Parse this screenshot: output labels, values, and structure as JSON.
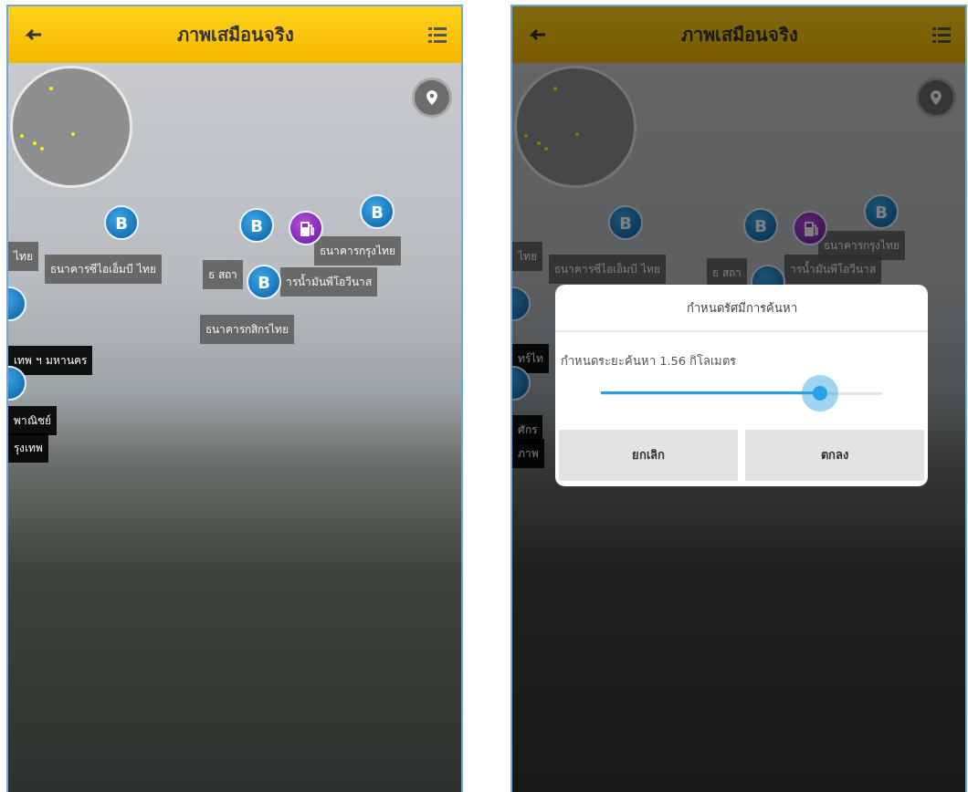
{
  "screens": [
    {
      "app_bar": {
        "title": "ภาพเสมือนจริง"
      },
      "markers": [
        {
          "kind": "bank",
          "symbol": "B"
        },
        {
          "kind": "bank",
          "symbol": "B"
        },
        {
          "kind": "fuel"
        },
        {
          "kind": "bank",
          "symbol": "B"
        },
        {
          "kind": "bank",
          "symbol": "B"
        },
        {
          "kind": "bank"
        },
        {
          "kind": "bank"
        }
      ],
      "place_labels": [
        {
          "text": "ไทย",
          "kind": "gray"
        },
        {
          "text": "ธนาคารซีไอเอ็มบี ไทย",
          "kind": "gray"
        },
        {
          "text": "ธ สถา",
          "kind": "gray"
        },
        {
          "text": "ธนาคารกรุงไทย",
          "kind": "gray"
        },
        {
          "text": "ารน้ำมันพีโอวีนาส",
          "kind": "gray"
        },
        {
          "text": "ธนาคารกสิกรไทย",
          "kind": "gray"
        },
        {
          "text": "เทพ ฯ มหานคร",
          "kind": "dark"
        },
        {
          "text": "พาณิชย์",
          "kind": "dark"
        },
        {
          "text": "รุงเทพ",
          "kind": "dark"
        }
      ]
    },
    {
      "app_bar": {
        "title": "ภาพเสมือนจริง"
      },
      "markers": [
        {
          "kind": "bank",
          "symbol": "B"
        },
        {
          "kind": "bank",
          "symbol": "B"
        },
        {
          "kind": "fuel"
        },
        {
          "kind": "bank",
          "symbol": "B"
        },
        {
          "kind": "bank"
        },
        {
          "kind": "bank"
        },
        {
          "kind": "bank"
        }
      ],
      "place_labels": [
        {
          "text": "ไทย",
          "kind": "gray"
        },
        {
          "text": "ธนาคารซีไอเอ็มบี ไทย",
          "kind": "gray"
        },
        {
          "text": "ธ สถา",
          "kind": "gray"
        },
        {
          "text": "ธนาคารกรุงไทย",
          "kind": "gray"
        },
        {
          "text": "ารน้ำมันพีโอวีนาส",
          "kind": "gray"
        },
        {
          "text": "ทร์ไท",
          "kind": "dark"
        },
        {
          "text": "ศักร",
          "kind": "dark"
        },
        {
          "text": "ภาพ",
          "kind": "dark"
        }
      ],
      "dialog": {
        "title": "กำหนดรัศมีการค้นหา",
        "message": "กำหนดระยะค้นหา 1.56 กิโลเมตร",
        "slider": {
          "level": 0.78
        },
        "buttons": [
          "ยกเลิก",
          "ตกลง"
        ]
      }
    }
  ]
}
